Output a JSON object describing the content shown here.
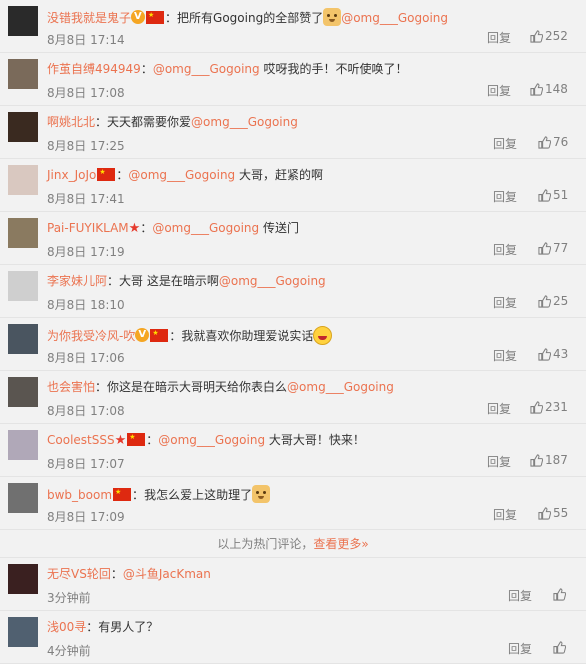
{
  "comments": [
    {
      "user": "没错我就是鬼子",
      "badges": [
        "crown",
        "flag"
      ],
      "sep": "：",
      "before": "把所有Gogoing的全部赞了",
      "emoji": "dog",
      "mention": "@omg___Gogoing",
      "after": "",
      "time": "8月8日 17:14",
      "reply": "回复",
      "likes": "252",
      "avatar_color": "#2a2a2a"
    },
    {
      "user": "作茧自缚494949",
      "badges": [],
      "sep": "：",
      "before": "",
      "emoji": "",
      "mention": "@omg___Gogoing",
      "after": " 哎呀我的手！不听使唤了！",
      "time": "8月8日 17:08",
      "reply": "回复",
      "likes": "148",
      "avatar_color": "#7a6a5a"
    },
    {
      "user": "啊姚北北",
      "badges": [],
      "sep": "：",
      "before": "天天都需要你爱",
      "emoji": "",
      "mention": "@omg___Gogoing",
      "after": "",
      "time": "8月8日 17:25",
      "reply": "回复",
      "likes": "76",
      "avatar_color": "#3a2a20"
    },
    {
      "user": "Jinx_JoJo",
      "badges": [
        "flag"
      ],
      "sep": "：",
      "before": "",
      "emoji": "",
      "mention": "@omg___Gogoing",
      "after": "  大哥，赶紧的啊",
      "time": "8月8日 17:41",
      "reply": "回复",
      "likes": "51",
      "avatar_color": "#d9c8c0"
    },
    {
      "user": "Pai-FUYIKLAM",
      "badges": [
        "star"
      ],
      "sep": "：",
      "before": "",
      "emoji": "",
      "mention": "@omg___Gogoing",
      "after": " 传送门",
      "time": "8月8日 17:19",
      "reply": "回复",
      "likes": "77",
      "avatar_color": "#8a7a60"
    },
    {
      "user": "李家妹儿阿",
      "badges": [],
      "sep": "：",
      "before": "大哥 这是在暗示啊",
      "emoji": "",
      "mention": "@omg___Gogoing",
      "after": "",
      "time": "8月8日 18:10",
      "reply": "回复",
      "likes": "25",
      "avatar_color": "#cfcfcf"
    },
    {
      "user": "为你我受冷风-吹",
      "badges": [
        "crown",
        "flag"
      ],
      "sep": "：",
      "before": "我就喜欢你助理爱说实话",
      "emoji": "laugh",
      "mention": "",
      "after": "",
      "time": "8月8日 17:06",
      "reply": "回复",
      "likes": "43",
      "avatar_color": "#4a5560"
    },
    {
      "user": "也会害怕",
      "badges": [],
      "sep": "：",
      "before": "你这是在暗示大哥明天给你表白么",
      "emoji": "",
      "mention": "@omg___Gogoing",
      "after": "",
      "time": "8月8日 17:08",
      "reply": "回复",
      "likes": "231",
      "avatar_color": "#5a5550"
    },
    {
      "user": "CoolestSSS",
      "badges": [
        "star",
        "flag"
      ],
      "sep": "：",
      "before": "",
      "emoji": "",
      "mention": "@omg___Gogoing",
      "after": " 大哥大哥！快来！",
      "time": "8月8日 17:07",
      "reply": "回复",
      "likes": "187",
      "avatar_color": "#b0a8b8"
    },
    {
      "user": "bwb_boom",
      "badges": [
        "flag"
      ],
      "sep": "：",
      "before": "我怎么爱上这助理了",
      "emoji": "dog",
      "mention": "",
      "after": "",
      "time": "8月8日 17:09",
      "reply": "回复",
      "likes": "55",
      "avatar_color": "#707070"
    }
  ],
  "hot_footer": {
    "text": "以上为热门评论，",
    "link": "查看更多»"
  },
  "recent": [
    {
      "user": "无尽VS轮回",
      "sep": "：",
      "mention": "@斗鱼JacKman",
      "after": "",
      "time": "3分钟前",
      "reply": "回复",
      "avatar_color": "#3a2020"
    },
    {
      "user": "浅00寻",
      "sep": "：",
      "mention": "",
      "after": "有男人了？",
      "time": "4分钟前",
      "reply": "回复",
      "avatar_color": "#506070"
    }
  ]
}
